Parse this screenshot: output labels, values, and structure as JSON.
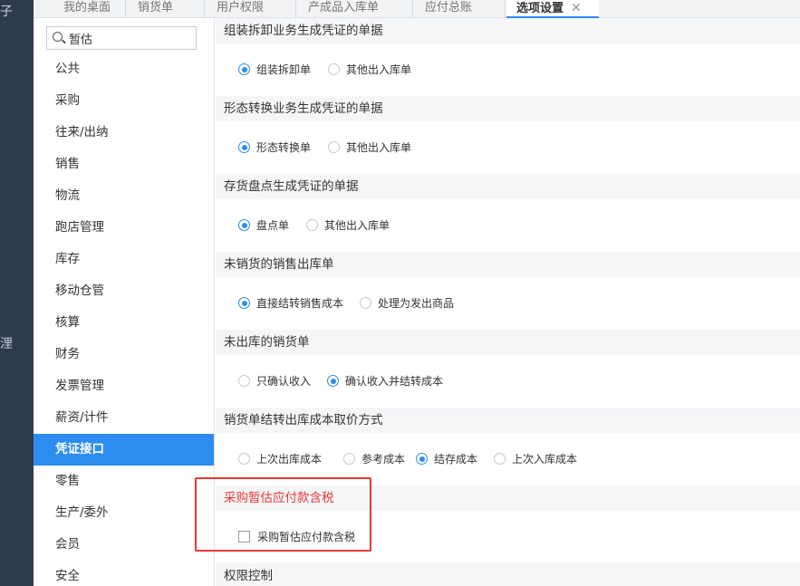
{
  "rail": {
    "glyph_top": "子",
    "glyph_mid": "浬"
  },
  "tabs": [
    {
      "label": "我的桌面"
    },
    {
      "label": "销货单"
    },
    {
      "label": "用户权限"
    },
    {
      "label": "产成品入库单"
    },
    {
      "label": "应付总账"
    },
    {
      "label": "选项设置",
      "close": "✕"
    }
  ],
  "search": {
    "value": "暂估"
  },
  "nav": [
    "公共",
    "采购",
    "往来/出纳",
    "销售",
    "物流",
    "跑店管理",
    "库存",
    "移动仓管",
    "核算",
    "财务",
    "发票管理",
    "薪资/计件",
    "凭证接口",
    "零售",
    "生产/委外",
    "会员",
    "安全"
  ],
  "nav_active": "凭证接口",
  "sections": [
    {
      "title": "组装拆卸业务生成凭证的单据",
      "options": [
        "组装拆卸单",
        "其他出入库单"
      ],
      "selected": 0
    },
    {
      "title": "形态转换业务生成凭证的单据",
      "options": [
        "形态转换单",
        "其他出入库单"
      ],
      "selected": 0
    },
    {
      "title": "存货盘点生成凭证的单据",
      "options": [
        "盘点单",
        "其他出入库单"
      ],
      "selected": 0
    },
    {
      "title": "未销货的销售出库单",
      "options": [
        "直接结转销售成本",
        "处理为发出商品"
      ],
      "selected": 0
    },
    {
      "title": "未出库的销货单",
      "options": [
        "只确认收入",
        "确认收入并结转成本"
      ],
      "selected": 1
    },
    {
      "title": "销货单结转出库成本取价方式",
      "options": [
        "上次出库成本",
        "参考成本",
        "结存成本",
        "上次入库成本"
      ],
      "selected": 2
    },
    {
      "title": "采购暂估应付款含税",
      "checkbox_label": "采购暂估应付款含税",
      "checked": false
    },
    {
      "title": "权限控制"
    }
  ],
  "colors": {
    "accent": "#2d8cf0",
    "highlight": "#e53935",
    "rail": "#2e3b4e"
  }
}
